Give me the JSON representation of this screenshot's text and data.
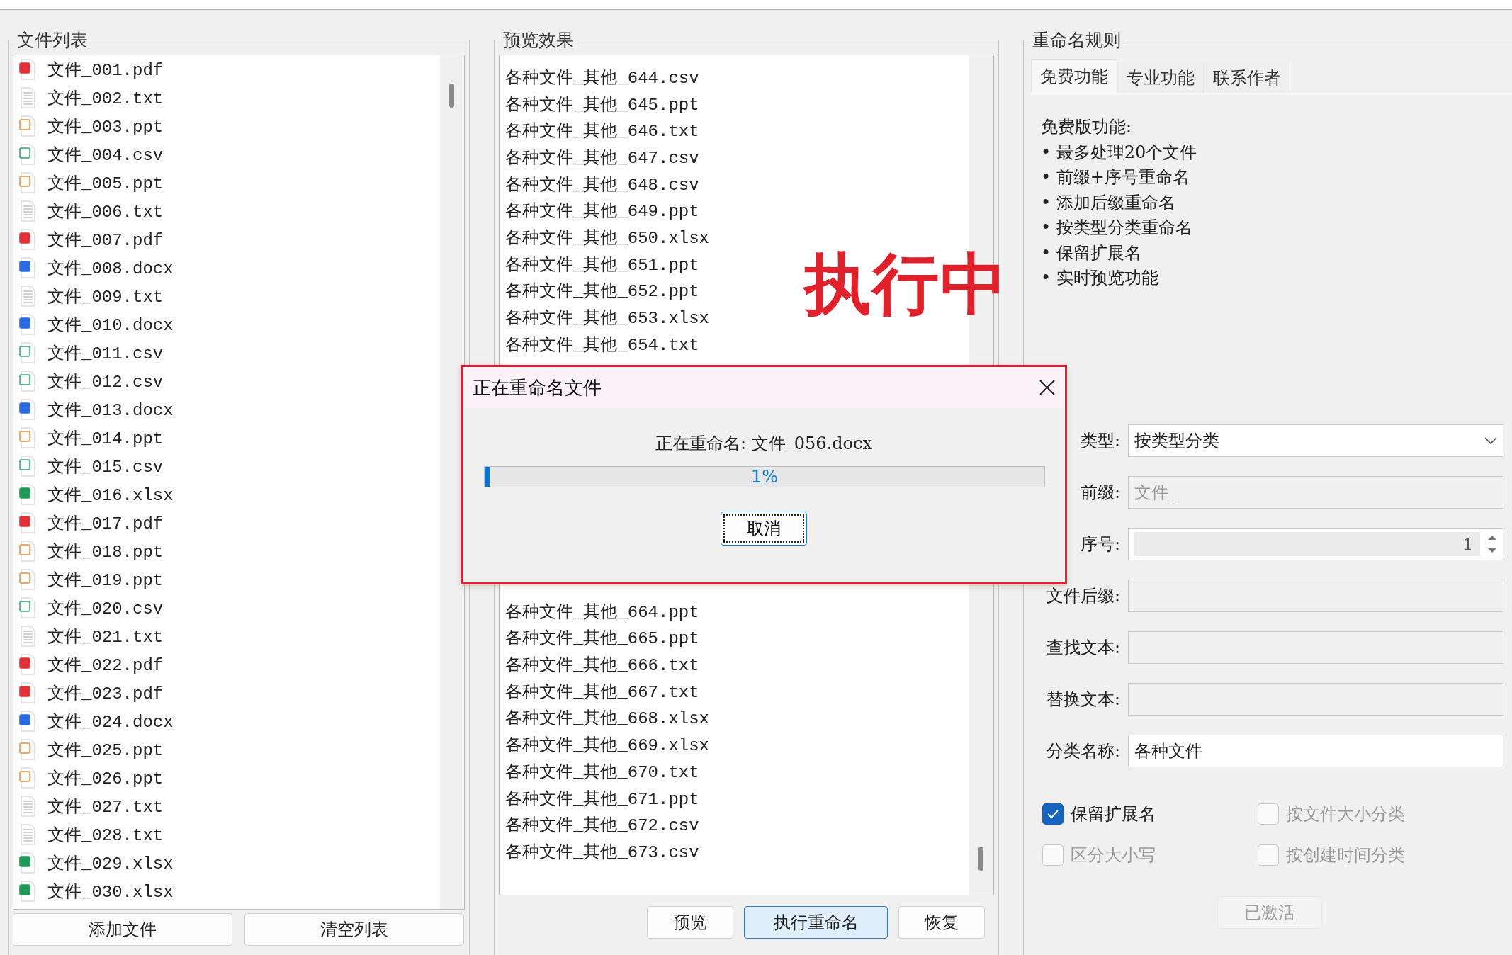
{
  "file_list": {
    "title": "文件列表",
    "files": [
      {
        "name": "文件_001.pdf",
        "kind": "pdf"
      },
      {
        "name": "文件_002.txt",
        "kind": "txt"
      },
      {
        "name": "文件_003.ppt",
        "kind": "ppt"
      },
      {
        "name": "文件_004.csv",
        "kind": "csv"
      },
      {
        "name": "文件_005.ppt",
        "kind": "ppt"
      },
      {
        "name": "文件_006.txt",
        "kind": "txt"
      },
      {
        "name": "文件_007.pdf",
        "kind": "pdf"
      },
      {
        "name": "文件_008.docx",
        "kind": "docx"
      },
      {
        "name": "文件_009.txt",
        "kind": "txt"
      },
      {
        "name": "文件_010.docx",
        "kind": "docx"
      },
      {
        "name": "文件_011.csv",
        "kind": "csv"
      },
      {
        "name": "文件_012.csv",
        "kind": "csv"
      },
      {
        "name": "文件_013.docx",
        "kind": "docx"
      },
      {
        "name": "文件_014.ppt",
        "kind": "ppt"
      },
      {
        "name": "文件_015.csv",
        "kind": "csv"
      },
      {
        "name": "文件_016.xlsx",
        "kind": "xlsx"
      },
      {
        "name": "文件_017.pdf",
        "kind": "pdf"
      },
      {
        "name": "文件_018.ppt",
        "kind": "ppt"
      },
      {
        "name": "文件_019.ppt",
        "kind": "ppt"
      },
      {
        "name": "文件_020.csv",
        "kind": "csv"
      },
      {
        "name": "文件_021.txt",
        "kind": "txt"
      },
      {
        "name": "文件_022.pdf",
        "kind": "pdf"
      },
      {
        "name": "文件_023.pdf",
        "kind": "pdf"
      },
      {
        "name": "文件_024.docx",
        "kind": "docx"
      },
      {
        "name": "文件_025.ppt",
        "kind": "ppt"
      },
      {
        "name": "文件_026.ppt",
        "kind": "ppt"
      },
      {
        "name": "文件_027.txt",
        "kind": "txt"
      },
      {
        "name": "文件_028.txt",
        "kind": "txt"
      },
      {
        "name": "文件_029.xlsx",
        "kind": "xlsx"
      },
      {
        "name": "文件_030.xlsx",
        "kind": "xlsx"
      }
    ],
    "buttons": [
      "添加文件",
      "清空列表"
    ]
  },
  "preview": {
    "title": "预览效果",
    "overlay_text": "执行中",
    "rows_above": [
      "各种文件_其他_644.csv",
      "各种文件_其他_645.ppt",
      "各种文件_其他_646.txt",
      "各种文件_其他_647.csv",
      "各种文件_其他_648.csv",
      "各种文件_其他_649.ppt",
      "各种文件_其他_650.xlsx",
      "各种文件_其他_651.ppt",
      "各种文件_其他_652.ppt",
      "各种文件_其他_653.xlsx",
      "各种文件_其他_654.txt"
    ],
    "rows_below": [
      "各种文件_其他_664.ppt",
      "各种文件_其他_665.ppt",
      "各种文件_其他_666.txt",
      "各种文件_其他_667.txt",
      "各种文件_其他_668.xlsx",
      "各种文件_其他_669.xlsx",
      "各种文件_其他_670.txt",
      "各种文件_其他_671.ppt",
      "各种文件_其他_672.csv",
      "各种文件_其他_673.csv"
    ],
    "buttons": [
      {
        "label": "预览",
        "focused": false
      },
      {
        "label": "执行重命名",
        "focused": true
      },
      {
        "label": "恢复",
        "focused": false
      }
    ]
  },
  "rules": {
    "title": "重命名规则",
    "tabs": [
      {
        "label": "免费功能",
        "selected": true
      },
      {
        "label": "专业功能",
        "selected": false
      },
      {
        "label": "联系作者",
        "selected": false
      }
    ],
    "features": {
      "heading": "免费版功能:",
      "items": [
        "• 最多处理20个文件",
        "• 前缀+序号重命名",
        "• 添加后缀重命名",
        "• 按类型分类重命名",
        "• 保留扩展名",
        "• 实时预览功能"
      ]
    },
    "fields": [
      {
        "kind": "select",
        "label": "类型:",
        "value": "按类型分类",
        "disabled": false
      },
      {
        "kind": "text",
        "label": "前缀:",
        "value": "文件_",
        "disabled": true
      },
      {
        "kind": "spin",
        "label": "序号:",
        "value": "1",
        "disabled": true
      },
      {
        "kind": "text",
        "label": "文件后缀:",
        "disabled": true
      },
      {
        "kind": "text",
        "label": "查找文本:",
        "disabled": true
      },
      {
        "kind": "text",
        "label": "替换文本:",
        "disabled": true
      },
      {
        "kind": "text",
        "label": "分类名称:",
        "value": "各种文件",
        "disabled": false
      }
    ],
    "checkboxes": [
      {
        "label": "保留扩展名",
        "checked": true,
        "disabled": false
      },
      {
        "label": "按文件大小分类",
        "checked": false,
        "disabled": true
      },
      {
        "label": "区分大小写",
        "checked": false,
        "disabled": true
      },
      {
        "label": "按创建时间分类",
        "checked": false,
        "disabled": true
      }
    ],
    "activate_button": {
      "label": "已激活",
      "disabled": true
    }
  },
  "dialog": {
    "title": "正在重命名文件",
    "message": "正在重命名: 文件_056.docx",
    "progress": {
      "level": 0.01,
      "reading": "1%"
    },
    "cancel": "取消"
  }
}
